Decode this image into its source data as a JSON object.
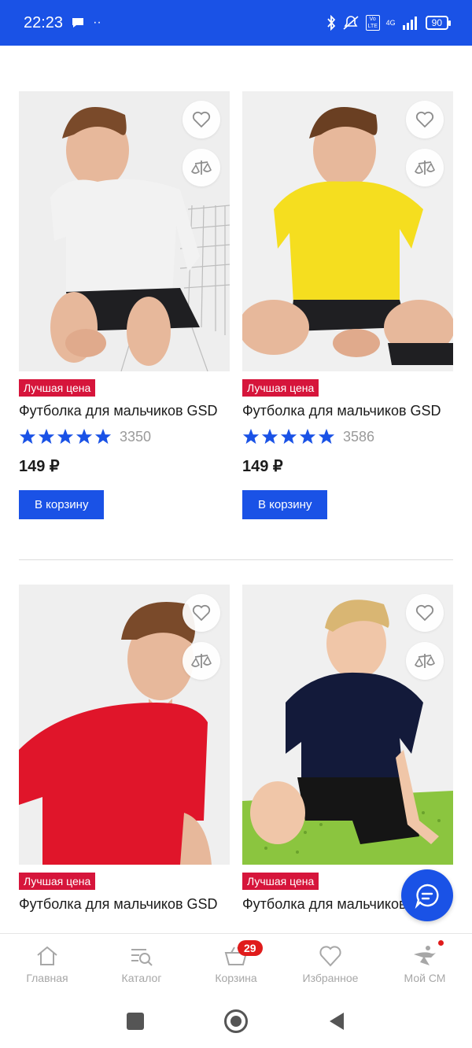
{
  "status_bar": {
    "time": "22:23",
    "battery": "90",
    "network": "4G",
    "volte": "Vo LTE",
    "icons": [
      "chat-bubble-icon",
      "more-dots-icon",
      "bluetooth-icon",
      "mute-icon",
      "volte-icon",
      "signal-icon",
      "battery-icon"
    ]
  },
  "products": [
    {
      "badge": "Лучшая цена",
      "title": "Футболка для мальчиков GSD",
      "rating_count": "3350",
      "stars": 5,
      "price": "149 ₽",
      "cart_label": "В корзину",
      "shirt_color": "#f2f2f2"
    },
    {
      "badge": "Лучшая цена",
      "title": "Футболка для мальчиков GSD",
      "rating_count": "3586",
      "stars": 5,
      "price": "149 ₽",
      "cart_label": "В корзину",
      "shirt_color": "#f5de1f"
    },
    {
      "badge": "Лучшая цена",
      "title": "Футболка для мальчиков GSD",
      "shirt_color": "#e0152a"
    },
    {
      "badge": "Лучшая цена",
      "title": "Футболка для мальчиков GSD",
      "shirt_color": "#131a3a"
    }
  ],
  "tabbar": {
    "items": [
      {
        "label": "Главная",
        "icon": "home-icon"
      },
      {
        "label": "Каталог",
        "icon": "catalog-search-icon"
      },
      {
        "label": "Корзина",
        "icon": "basket-icon",
        "badge": "29"
      },
      {
        "label": "Избранное",
        "icon": "heart-icon"
      },
      {
        "label": "Мой СМ",
        "icon": "sportmaster-profile-icon"
      }
    ]
  },
  "colors": {
    "accent": "#1a52e6",
    "badge": "#d6153b",
    "star": "#1a52e6",
    "muted": "#a7a7a7"
  }
}
